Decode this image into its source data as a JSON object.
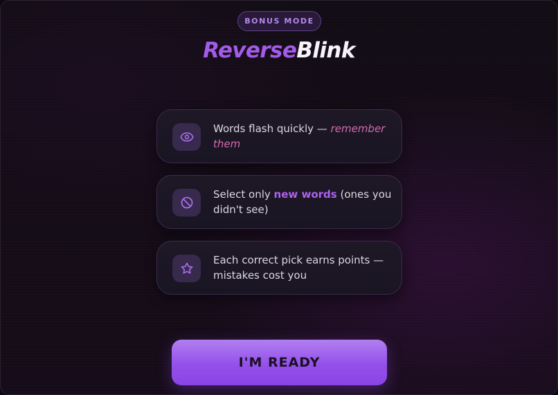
{
  "badge": "BONUS MODE",
  "title": {
    "part1": "Reverse",
    "part2": "Blink"
  },
  "rules": [
    {
      "icon": "eye-icon",
      "text_before": "Words flash quickly — ",
      "highlight": "remember them",
      "text_after": ""
    },
    {
      "icon": "ban-icon",
      "text_before": "Select only ",
      "highlight": "new words",
      "text_after": " (ones you didn't see)"
    },
    {
      "icon": "star-icon",
      "text_before": "Each correct pick earns points — mistakes cost you",
      "highlight": "",
      "text_after": ""
    }
  ],
  "cta_label": "I'M READY",
  "colors": {
    "accent": "#a35be8",
    "highlight_pink": "#d46bb0",
    "button_top": "#b17ff0",
    "button_bottom": "#8a44e4"
  }
}
